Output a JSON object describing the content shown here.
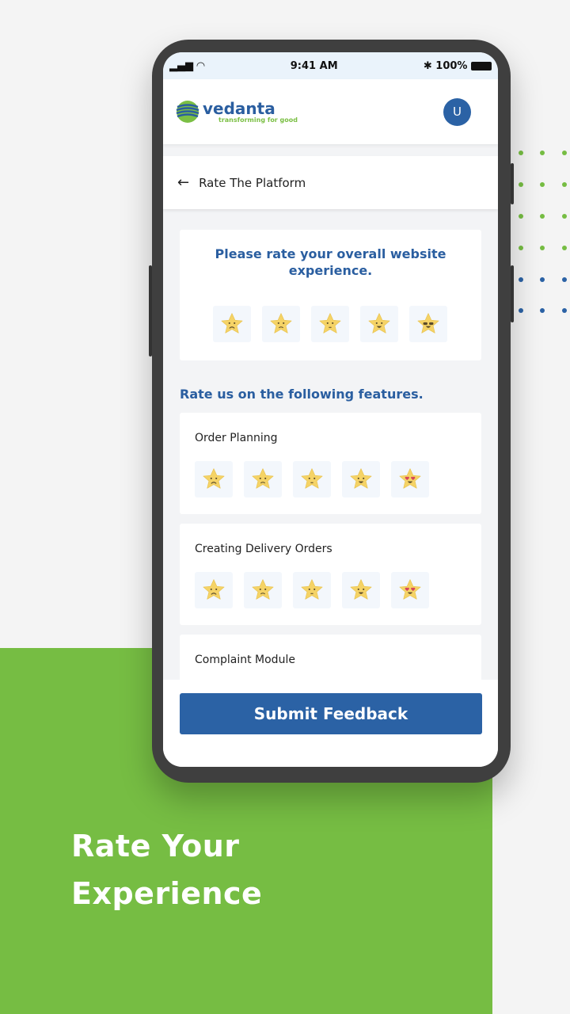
{
  "status_bar": {
    "time": "9:41 AM",
    "battery": "100%"
  },
  "header": {
    "logo_name": "vedanta",
    "logo_tagline": "transforming for good",
    "avatar_initial": "U"
  },
  "page": {
    "title": "Rate The Platform"
  },
  "overall": {
    "question": "Please rate your overall website experience.",
    "moods": [
      "sad",
      "frown",
      "neutral",
      "smile",
      "cool"
    ]
  },
  "features_title": "Rate us on the following features.",
  "features": [
    {
      "label": "Order Planning",
      "moods": [
        "sad",
        "frown",
        "neutral",
        "smile",
        "love"
      ]
    },
    {
      "label": "Creating Delivery Orders",
      "moods": [
        "sad",
        "frown",
        "neutral",
        "smile",
        "love"
      ]
    },
    {
      "label": "Complaint Module"
    }
  ],
  "submit_label": "Submit Feedback",
  "tagline": {
    "line1": "Rate Your",
    "line2": "Experience"
  },
  "colors": {
    "brand_blue": "#2b62a5",
    "brand_green": "#76bd43",
    "star": "#f5d366"
  }
}
